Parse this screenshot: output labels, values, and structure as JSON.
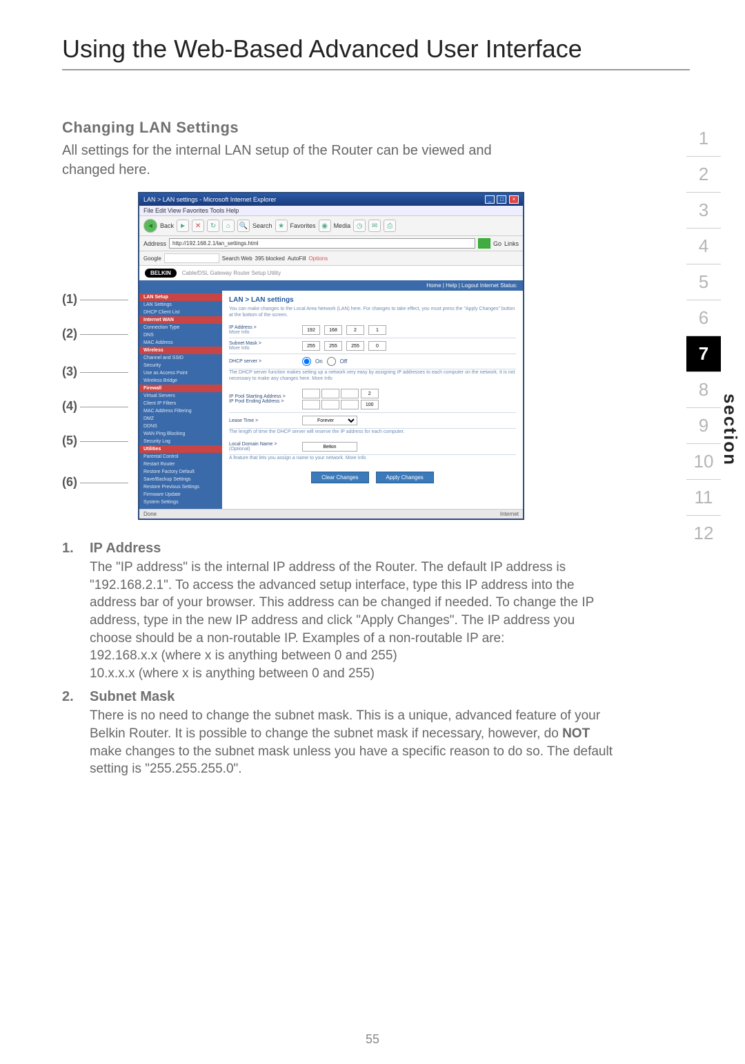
{
  "page_title": "Using the Web-Based Advanced User Interface",
  "section_heading": "Changing LAN Settings",
  "section_intro": "All settings for the internal LAN setup of the Router can be viewed and changed here.",
  "callouts": [
    "(1)",
    "(2)",
    "(3)",
    "(4)",
    "(5)",
    "(6)"
  ],
  "browser": {
    "title": "LAN > LAN settings - Microsoft Internet Explorer",
    "menubar": "File   Edit   View   Favorites   Tools   Help",
    "back_label": "Back",
    "search_label": "Search",
    "favorites_label": "Favorites",
    "media_label": "Media",
    "address_label": "Address",
    "address_value": "http://192.168.2.1/lan_settings.html",
    "go_label": "Go",
    "links_label": "Links",
    "google_label": "Google",
    "search_web_label": "Search Web",
    "blocked_label": "395 blocked",
    "autofill_label": "AutoFill",
    "options_label": "Options",
    "belkin_logo": "BELKIN",
    "belkin_tagline": "Cable/DSL Gateway Router Setup Utility",
    "subhead": "Home | Help | Logout     Internet Status:",
    "sidebar": {
      "groups": [
        {
          "head": "LAN Setup",
          "items": [
            "LAN Settings",
            "DHCP Client List"
          ]
        },
        {
          "head": "Internet WAN",
          "items": [
            "Connection Type",
            "DNS",
            "MAC Address"
          ]
        },
        {
          "head": "Wireless",
          "items": [
            "Channel and SSID",
            "Security",
            "Use as Access Point",
            "Wireless Bridge"
          ]
        },
        {
          "head": "Firewall",
          "items": [
            "Virtual Servers",
            "Client IP Filters",
            "MAC Address Filtering",
            "DMZ",
            "DDNS",
            "WAN Ping Blocking",
            "Security Log"
          ]
        },
        {
          "head": "Utilities",
          "items": [
            "Parental Control",
            "Restart Router",
            "Restore Factory Default",
            "Save/Backup Settings",
            "Restore Previous Settings",
            "Firmware Update",
            "System Settings"
          ]
        }
      ]
    },
    "main": {
      "title": "LAN > LAN settings",
      "help1": "You can make changes to the Local Area Network (LAN) here. For changes to take effect, you must press the \"Apply Changes\" button at the bottom of the screen.",
      "ip_label": "IP Address >",
      "ip": [
        "192",
        "168",
        "2",
        "1"
      ],
      "more_info": "More Info",
      "subnet_label": "Subnet Mask >",
      "subnet": [
        "255",
        "255",
        "255",
        "0"
      ],
      "dhcp_label": "DHCP server >",
      "dhcp_on": "On",
      "dhcp_off": "Off",
      "dhcp_help": "The DHCP server function makes setting up a network very easy by assigning IP addresses to each computer on the network. It is not necessary to make any changes here. More Info",
      "pool_start_label": "IP Pool Starting Address >",
      "pool_end_label": "IP Pool Ending Address >",
      "pool_start_last": "2",
      "pool_end_last": "100",
      "lease_label": "Lease Time >",
      "lease_value": "Forever",
      "lease_help": "The length of time the DHCP server will reserve the IP address for each computer.",
      "domain_label": "Local Domain Name >",
      "domain_optional": "(Optional)",
      "domain_value": "Belkin",
      "domain_help": "A feature that lets you assign a name to your network. More Info",
      "clear_btn": "Clear Changes",
      "apply_btn": "Apply Changes"
    },
    "status_done": "Done",
    "status_internet": "Internet"
  },
  "items": [
    {
      "n": "1.",
      "title": "IP Address",
      "text": "The \"IP address\" is the internal IP address of the Router. The default IP address is \"192.168.2.1\". To access the advanced setup interface, type this IP address into the address bar of your browser. This address can be changed if needed. To change the IP address, type in the new IP address and click \"Apply Changes\". The IP address you choose should be a non-routable IP. Examples of a non-routable IP are:\n192.168.x.x (where x is anything between 0 and 255)\n10.x.x.x (where x is anything between 0 and 255)"
    },
    {
      "n": "2.",
      "title": "Subnet Mask",
      "text_pre": "There is no need to change the subnet mask. This is a unique, advanced feature of your Belkin Router. It is possible to change the subnet mask if necessary, however, do ",
      "text_strong": "NOT",
      "text_post": " make changes to the subnet mask unless you have a specific reason to do so. The default setting is \"255.255.255.0\"."
    }
  ],
  "section_nav": {
    "pages": [
      "1",
      "2",
      "3",
      "4",
      "5",
      "6",
      "7",
      "8",
      "9",
      "10",
      "11",
      "12"
    ],
    "current": "7",
    "label": "section"
  },
  "page_number": "55"
}
